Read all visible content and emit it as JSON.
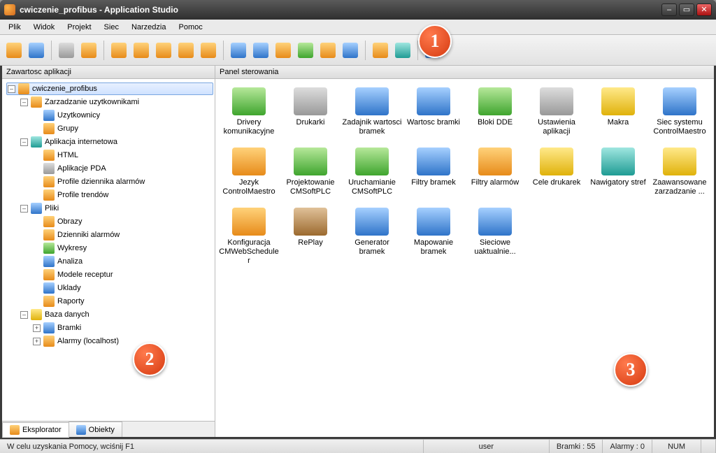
{
  "title": "cwiczenie_profibus - Application Studio",
  "winbuttons": {
    "min": "–",
    "max": "▭",
    "close": "✕"
  },
  "menu": [
    "Plik",
    "Widok",
    "Projekt",
    "Siec",
    "Narzedzia",
    "Pomoc"
  ],
  "left_panel_title": "Zawartosc aplikacji",
  "main_panel_title": "Panel sterowania",
  "tree": {
    "root": "cwiczenie_profibus",
    "groups": [
      {
        "label": "Zarzadzanie uzytkownikami",
        "children": [
          "Uzytkownicy",
          "Grupy"
        ]
      },
      {
        "label": "Aplikacja internetowa",
        "children": [
          "HTML",
          "Aplikacje PDA",
          "Profile dziennika alarmów",
          "Profile trendów"
        ]
      },
      {
        "label": "Pliki",
        "children": [
          "Obrazy",
          "Dzienniki alarmów",
          "Wykresy",
          "Analiza",
          "Modele receptur",
          "Uklady",
          "Raporty"
        ]
      },
      {
        "label": "Baza danych",
        "children": [
          "Bramki",
          "Alarmy (localhost)"
        ]
      }
    ]
  },
  "bottom_tabs": {
    "explorer": "Eksplorator",
    "objects": "Obiekty"
  },
  "cards": [
    [
      "Drivery komunikacyjne",
      "Drukarki",
      "Zadajnik wartosci bramek",
      "Wartosc bramki",
      "Bloki DDE",
      "Ustawienia aplikacji",
      "Makra",
      "Siec systemu ControlMaestro"
    ],
    [
      "Jezyk ControlMaestro",
      "Projektowanie CMSoftPLC",
      "Uruchamianie CMSoftPLC",
      "Filtry bramek",
      "Filtry alarmów",
      "Cele drukarek",
      "Nawigatory stref",
      "Zaawansowane zarzadzanie ..."
    ],
    [
      "Konfiguracja CMWebScheduler",
      "RePlay",
      "Generator bramek",
      "Mapowanie bramek",
      "Sieciowe uaktualnie..."
    ]
  ],
  "status": {
    "help": "W celu uzyskania Pomocy, wciśnij F1",
    "user": "user",
    "bramki": "Bramki : 55",
    "alarmy": "Alarmy : 0",
    "num": "NUM"
  },
  "annotations": {
    "a1": "1",
    "a2": "2",
    "a3": "3"
  }
}
